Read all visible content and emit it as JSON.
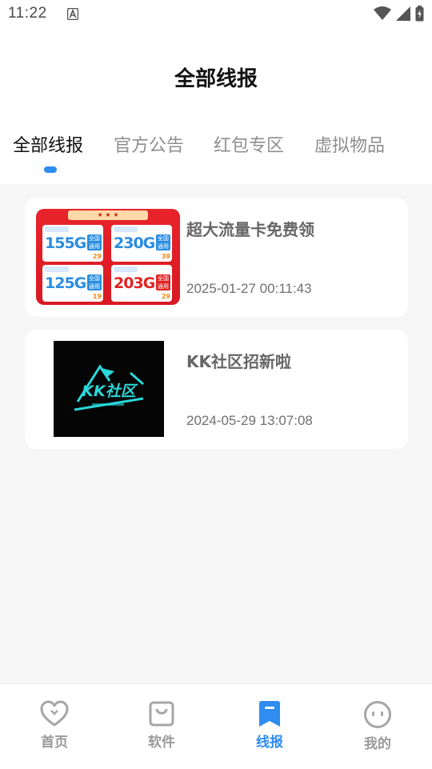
{
  "status_bar": {
    "time": "11:22",
    "icons": [
      "a-icon",
      "wifi-icon",
      "signal-icon",
      "battery-icon"
    ]
  },
  "header": {
    "title": "全部线报"
  },
  "tabs": [
    {
      "label": "全部线报",
      "active": true
    },
    {
      "label": "官方公告",
      "active": false
    },
    {
      "label": "红包专区",
      "active": false
    },
    {
      "label": "虚拟物品",
      "active": false
    }
  ],
  "posts": [
    {
      "title": "超大流量卡免费领",
      "date": "2025-01-27 00:11:43",
      "thumbnail": {
        "plans": [
          "155G",
          "230G",
          "125G",
          "203G"
        ]
      }
    },
    {
      "title": "KK社区招新啦",
      "date": "2024-05-29 13:07:08",
      "thumbnail": {
        "logo_text": "KK社区"
      }
    }
  ],
  "bottom_nav": [
    {
      "label": "首页",
      "icon": "heart-icon",
      "active": false
    },
    {
      "label": "软件",
      "icon": "bag-icon",
      "active": false
    },
    {
      "label": "线报",
      "icon": "bookmark-icon",
      "active": true
    },
    {
      "label": "我的",
      "icon": "smile-icon",
      "active": false
    }
  ],
  "colors": {
    "accent": "#2f8cf0",
    "inactive": "#9a9a9a",
    "background": "#f6f6f6"
  }
}
